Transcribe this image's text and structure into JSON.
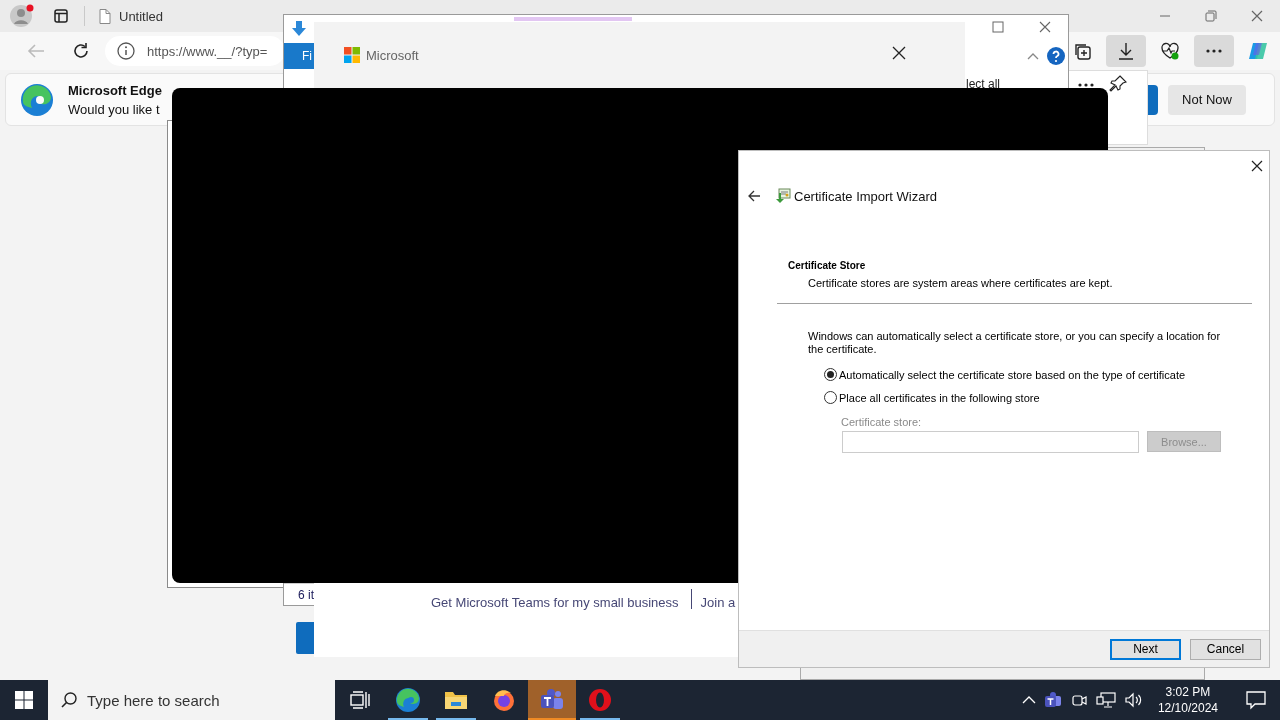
{
  "browser": {
    "tab_title": "Untitled",
    "address": "https://www.__/?typ=",
    "notification": {
      "title": "Microsoft Edge",
      "message": "Would you like t",
      "dismiss": "Not Now"
    }
  },
  "download_window": {
    "tab_label": "Fi",
    "select_all": "lect all",
    "item_count": "6 it"
  },
  "teams_window": {
    "brand": "Microsoft",
    "footer_links": [
      "Get Microsoft Teams for my small business",
      "Join a"
    ]
  },
  "wizard": {
    "title": "Certificate Import Wizard",
    "heading": "Certificate Store",
    "subheading": "Certificate stores are system areas where certificates are kept.",
    "body": "Windows can automatically select a certificate store, or you can specify a location for the certificate.",
    "options": [
      {
        "label": "Automatically select the certificate store based on the type of certificate",
        "selected": true
      },
      {
        "label": "Place all certificates in the following store",
        "selected": false
      }
    ],
    "store_label": "Certificate store:",
    "browse": {
      "label": "Browse...",
      "disabled": true
    },
    "buttons": [
      {
        "label": "Next",
        "default": true
      },
      {
        "label": "Cancel",
        "default": false
      }
    ]
  },
  "taskbar": {
    "search_placeholder": "Type here to search",
    "apps": [
      {
        "kind": "task-view",
        "running": false,
        "active": false
      },
      {
        "kind": "edge",
        "running": true,
        "active": false
      },
      {
        "kind": "explorer",
        "running": true,
        "active": false
      },
      {
        "kind": "firefox",
        "running": false,
        "active": false
      },
      {
        "kind": "teams",
        "running": true,
        "active": true
      },
      {
        "kind": "opera",
        "running": true,
        "active": false
      }
    ],
    "time": "3:02 PM",
    "date": "12/10/2024"
  }
}
